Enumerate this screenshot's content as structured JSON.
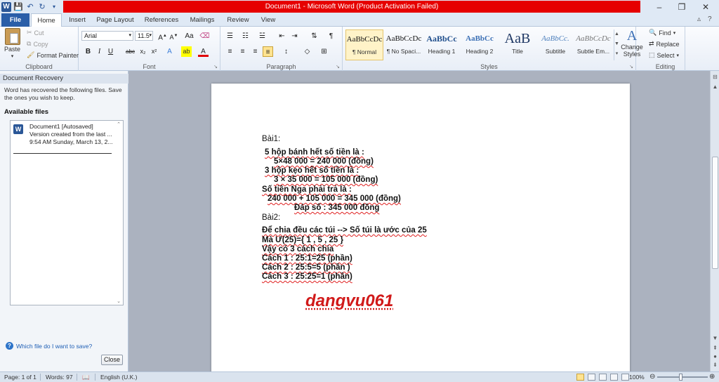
{
  "window": {
    "title": "Document1 - Microsoft Word (Product Activation Failed)",
    "minimize": "–",
    "restore": "❐",
    "close": "✕"
  },
  "qat": {
    "app_icon": "W"
  },
  "tabs": [
    {
      "label": "File"
    },
    {
      "label": "Home"
    },
    {
      "label": "Insert"
    },
    {
      "label": "Page Layout"
    },
    {
      "label": "References"
    },
    {
      "label": "Mailings"
    },
    {
      "label": "Review"
    },
    {
      "label": "View"
    }
  ],
  "ribbon": {
    "clipboard": {
      "label": "Clipboard",
      "paste": "Paste",
      "cut": "Cut",
      "copy": "Copy",
      "format_painter": "Format Painter"
    },
    "font": {
      "label": "Font",
      "family": "Arial",
      "size": "11.5"
    },
    "paragraph": {
      "label": "Paragraph"
    },
    "styles": {
      "label": "Styles",
      "items": [
        {
          "preview": "AaBbCcDc",
          "name": "¶ Normal"
        },
        {
          "preview": "AaBbCcDc",
          "name": "¶ No Spaci..."
        },
        {
          "preview": "AaBbCc",
          "name": "Heading 1"
        },
        {
          "preview": "AaBbCc",
          "name": "Heading 2"
        },
        {
          "preview": "AaB",
          "name": "Title"
        },
        {
          "preview": "AaBbCc.",
          "name": "Subtitle"
        },
        {
          "preview": "AaBbCcDc",
          "name": "Subtle Em..."
        }
      ],
      "change_styles": "Change Styles"
    },
    "editing": {
      "label": "Editing",
      "find": "Find",
      "replace": "Replace",
      "select": "Select"
    }
  },
  "recovery": {
    "title": "Document Recovery",
    "message": "Word has recovered the following files.  Save the ones you wish to keep.",
    "available": "Available files",
    "file": {
      "name": "Document1  [Autosaved]",
      "line2": "Version created from the last ...",
      "line3": "9:54 AM Sunday, March 13, 2..."
    },
    "help": "Which file do I want to save?",
    "close": "Close"
  },
  "document": {
    "heading1": "Bài1:",
    "p1": "5 hộp bánh hết số tiền là :",
    "p2": "5×48 000 = 240 000 (đồng)",
    "p3": "3 hộp kẹo hết số tiền là :",
    "p4": "3 × 35 000 = 105 000 (đồng)",
    "p5": "Số tiền Nga phải trả là :",
    "p6": "240 000 + 105 000 = 345 000 (đồng)",
    "p7": "Đáp số : 345 000 đồng",
    "heading2": "Bài2:",
    "q1": "Để chia đều các túi --> Số túi là ước của 25",
    "q2": "Mà Ư(25)={ 1 , 5 , 25 }",
    "q3": "Vậy có 3 cách chia",
    "q4": "Cách 1 : 25:1=25 (phần)",
    "q5": "Cách 2 : 25:5=5 (phần )",
    "q6": "Cách 3 : 25:25=1 (phần)",
    "signature": "dangvu061"
  },
  "status": {
    "page": "Page: 1 of 1",
    "words": "Words: 97",
    "language": "English (U.K.)",
    "zoom": "100%"
  },
  "colors": {
    "title_bar_warning": "#e60000",
    "file_tab": "#2a5ea8",
    "signature": "#d11919"
  }
}
